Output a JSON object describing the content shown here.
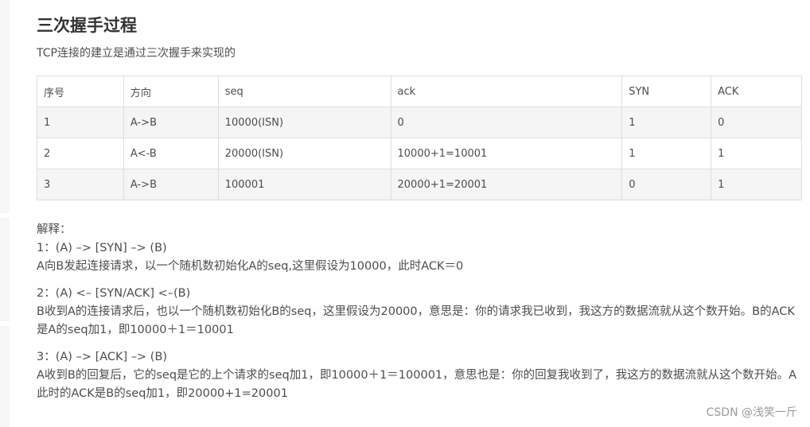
{
  "section": {
    "title": "三次握手过程",
    "intro": "TCP连接的建立是通过三次握手来实现的"
  },
  "table": {
    "headers": [
      "序号",
      "方向",
      "seq",
      "ack",
      "SYN",
      "ACK"
    ],
    "rows": [
      [
        "1",
        "A->B",
        "10000(ISN)",
        "0",
        "1",
        "0"
      ],
      [
        "2",
        "A<-B",
        "20000(ISN)",
        "10000+1=10001",
        "1",
        "1"
      ],
      [
        "3",
        "A->B",
        "100001",
        "20000+1=20001",
        "0",
        "1"
      ]
    ]
  },
  "explanation": {
    "heading": "解释：",
    "steps": [
      {
        "line": "1：(A) –> [SYN] –> (B)",
        "text": "A向B发起连接请求，以一个随机数初始化A的seq,这里假设为10000，此时ACK＝0"
      },
      {
        "line": "2：(A) <– [SYN/ACK] <–(B)",
        "text": "B收到A的连接请求后，也以一个随机数初始化B的seq，这里假设为20000，意思是：你的请求我已收到，我这方的数据流就从这个数开始。B的ACK是A的seq加1，即10000＋1＝10001"
      },
      {
        "line": "3：(A) –> [ACK] –> (B)",
        "text": "A收到B的回复后，它的seq是它的上个请求的seq加1，即10000＋1＝100001，意思也是：你的回复我收到了，我这方的数据流就从这个数开始。A此时的ACK是B的seq加1，即20000+1=20001"
      }
    ]
  },
  "watermark": "CSDN @浅笑一斤"
}
